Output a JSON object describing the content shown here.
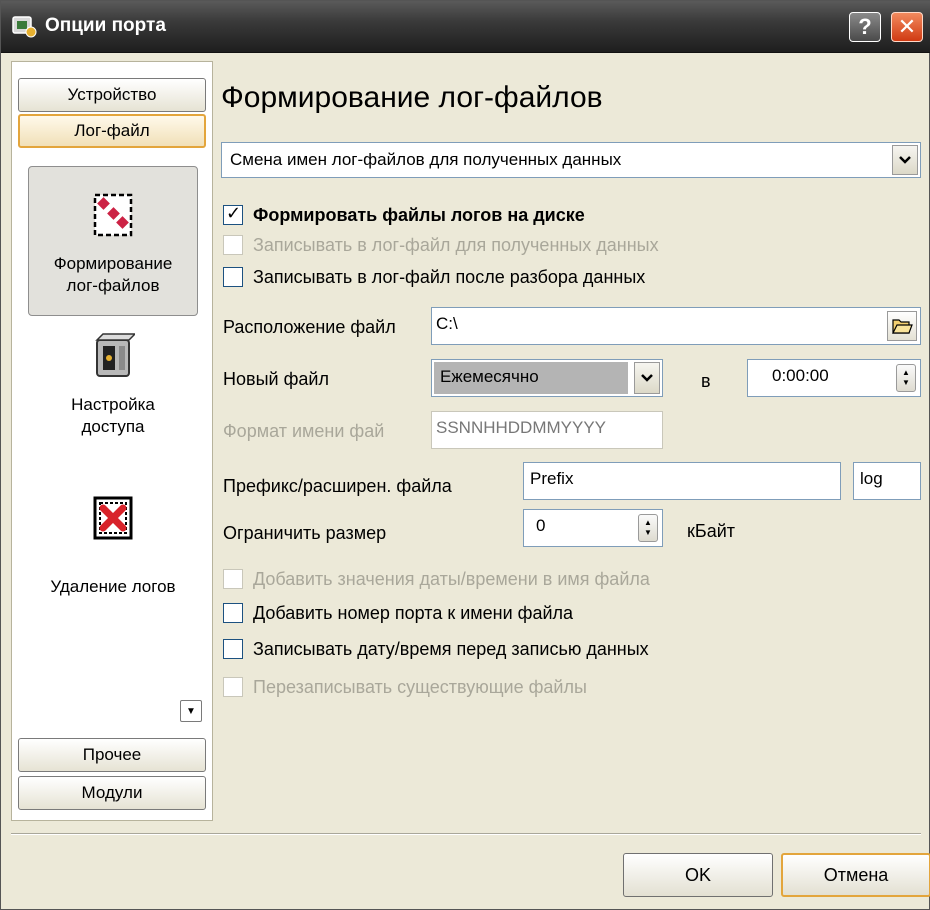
{
  "window": {
    "title": "Опции порта",
    "help": "?",
    "close": "✕"
  },
  "sidebar": {
    "top_buttons": [
      "Устройство",
      "Лог-файл"
    ],
    "items": [
      {
        "label_line1": "Формирование",
        "label_line2": "лог-файлов",
        "icon": "log-files-icon",
        "selected": true
      },
      {
        "label_line1": "Настройка",
        "label_line2": "доступа",
        "icon": "server-access-icon"
      },
      {
        "label_line1": "Удаление логов",
        "icon": "delete-logs-icon"
      }
    ],
    "bottom_buttons": [
      "Прочее",
      "Модули"
    ]
  },
  "page": {
    "title": "Формирование лог-файлов",
    "mode_select": "Смена имен лог-файлов для полученных данных",
    "checks_top": [
      {
        "label": "Формировать файлы логов на диске",
        "checked": true,
        "bold": true,
        "enabled": true
      },
      {
        "label": "Записывать в лог-файл для полученных данных",
        "checked": false,
        "enabled": false
      },
      {
        "label": "Записывать в лог-файл после разбора данных",
        "checked": false,
        "enabled": true
      }
    ],
    "location_label": "Расположение файл",
    "location_value": "C:\\",
    "new_file_label": "Новый файл",
    "new_file_select": "Ежемесячно",
    "at_label": "в",
    "time_value": "0:00:00",
    "name_format_label": "Формат имени фай",
    "name_format_value": "SSNNHHDDMMYYYY",
    "prefix_label": "Префикс/расширен. файла",
    "prefix_value": "Prefix",
    "ext_value": "log",
    "limit_label": "Ограничить размер",
    "limit_value": "0",
    "limit_unit": "кБайт",
    "checks_bottom": [
      {
        "label": "Добавить значения даты/времени в имя файла",
        "checked": false,
        "enabled": false
      },
      {
        "label": "Добавить номер порта к имени файла",
        "checked": false,
        "enabled": true
      },
      {
        "label": "Записывать дату/время перед записью данных",
        "checked": false,
        "enabled": true
      },
      {
        "label": "Перезаписывать существующие файлы",
        "checked": false,
        "enabled": false
      }
    ]
  },
  "buttons": {
    "ok": "OK",
    "cancel": "Отмена"
  }
}
